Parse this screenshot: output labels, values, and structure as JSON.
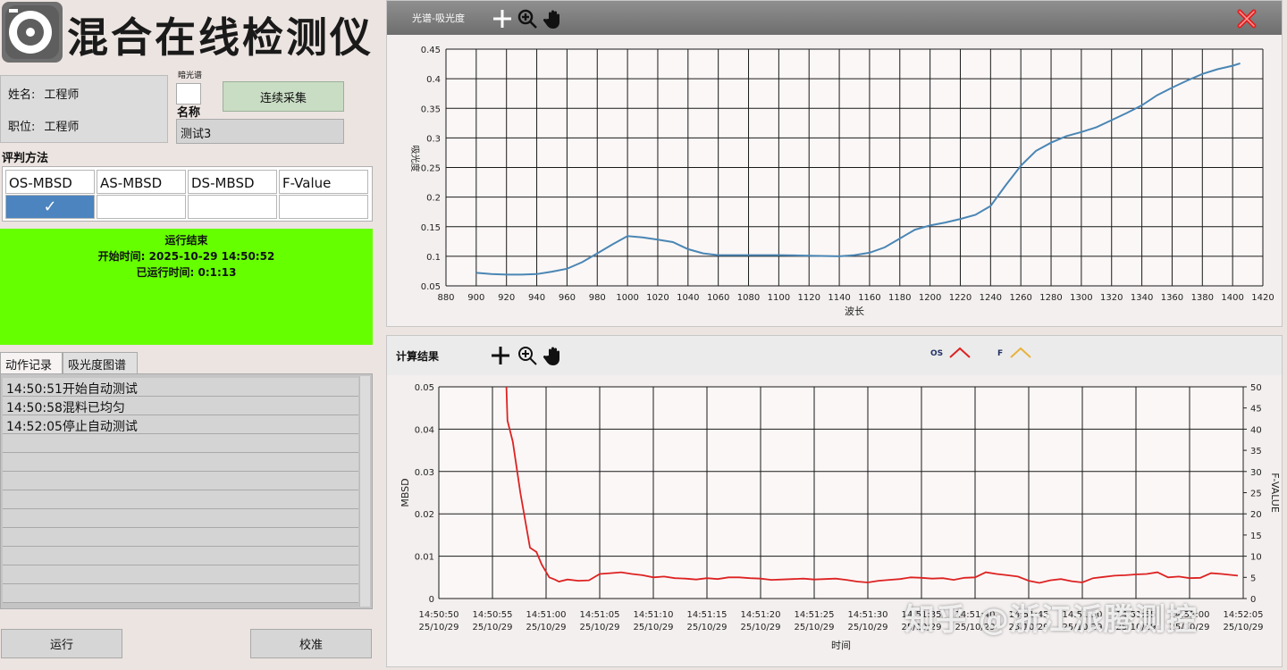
{
  "app": {
    "title": "混合在线检测仪",
    "user": {
      "name_label": "姓名:",
      "name_value": "工程师",
      "role_label": "职位:",
      "role_value": "工程师"
    },
    "dark_spectrum_label": "暗光谱",
    "collect_button": "连续采集",
    "sample_name_label": "名称",
    "sample_name_value": "测试3"
  },
  "method": {
    "label": "评判方法",
    "options": [
      "OS-MBSD",
      "AS-MBSD",
      "DS-MBSD",
      "F-Value"
    ],
    "selected_mark": "✓"
  },
  "status": {
    "title": "运行结束",
    "start_label": "开始时间:",
    "start_value": "2025-10-29 14:50:52",
    "elapsed_label": "已运行时间:",
    "elapsed_value": "0:1:13",
    "color": "#66ff00"
  },
  "tabs": [
    "动作记录",
    "吸光度图谱"
  ],
  "log": [
    "14:50:51开始自动测试",
    "14:50:58混料已均匀",
    "14:52:05停止自动测试"
  ],
  "buttons": {
    "run": "运行",
    "calibrate": "校准"
  },
  "spectrum": {
    "title": "光谱-吸光度",
    "xlabel": "波长",
    "ylabel": "吸光度",
    "icons": [
      "crosshair-icon",
      "zoom-icon",
      "pan-hand-icon",
      "close-icon"
    ]
  },
  "calc": {
    "title": "计算结果",
    "xlabel": "时间",
    "ylabel_left": "MBSD",
    "ylabel_right": "F-VALUE",
    "legend": [
      {
        "name": "OS",
        "color": "#dd2222"
      },
      {
        "name": "F",
        "color": "#e8b23a"
      }
    ]
  },
  "watermark": "知乎 @浙江派腾测控",
  "chart_data": [
    {
      "type": "line",
      "title": "光谱-吸光度",
      "xlabel": "波长",
      "ylabel": "吸光度",
      "xlim": [
        880,
        1420
      ],
      "ylim": [
        0.05,
        0.45
      ],
      "xticks": [
        "880",
        "900",
        "920",
        "940",
        "960",
        "980",
        "1000",
        "1020",
        "1040",
        "1060",
        "1080",
        "1100",
        "1120",
        "1140",
        "1160",
        "1180",
        "1200",
        "1220",
        "1240",
        "1260",
        "1280",
        "1300",
        "1320",
        "1340",
        "1360",
        "1380",
        "1400",
        "1420"
      ],
      "yticks": [
        "0.05",
        "0.1",
        "0.15",
        "0.2",
        "0.25",
        "0.3",
        "0.35",
        "0.4",
        "0.45"
      ],
      "grid": true,
      "series": [
        {
          "color": "#4a86b4",
          "x": [
            900,
            910,
            920,
            930,
            940,
            950,
            960,
            970,
            980,
            990,
            1000,
            1010,
            1020,
            1030,
            1040,
            1050,
            1060,
            1080,
            1100,
            1120,
            1140,
            1150,
            1160,
            1170,
            1180,
            1190,
            1200,
            1210,
            1220,
            1230,
            1240,
            1250,
            1260,
            1270,
            1280,
            1290,
            1300,
            1310,
            1320,
            1330,
            1340,
            1350,
            1360,
            1370,
            1380,
            1390,
            1400,
            1405
          ],
          "y": [
            0.072,
            0.07,
            0.069,
            0.069,
            0.07,
            0.074,
            0.079,
            0.09,
            0.105,
            0.12,
            0.134,
            0.132,
            0.128,
            0.124,
            0.112,
            0.105,
            0.102,
            0.102,
            0.102,
            0.101,
            0.1,
            0.102,
            0.106,
            0.115,
            0.13,
            0.145,
            0.152,
            0.157,
            0.163,
            0.17,
            0.185,
            0.22,
            0.253,
            0.278,
            0.292,
            0.303,
            0.31,
            0.318,
            0.33,
            0.342,
            0.355,
            0.372,
            0.385,
            0.397,
            0.408,
            0.416,
            0.422,
            0.426
          ]
        }
      ]
    },
    {
      "type": "line",
      "title": "计算结果",
      "xlabel": "时间",
      "ylabel": "MBSD",
      "y2label": "F-VALUE",
      "ylim": [
        0,
        0.05
      ],
      "y2lim": [
        0,
        50
      ],
      "yticks": [
        "0",
        "0.01",
        "0.02",
        "0.03",
        "0.04",
        "0.05"
      ],
      "y2ticks": [
        "0",
        "5",
        "10",
        "15",
        "20",
        "25",
        "30",
        "35",
        "40",
        "45",
        "50"
      ],
      "xticks": [
        [
          "14:50:50",
          "25/10/29"
        ],
        [
          "14:50:55",
          "25/10/29"
        ],
        [
          "14:51:00",
          "25/10/29"
        ],
        [
          "14:51:05",
          "25/10/29"
        ],
        [
          "14:51:10",
          "25/10/29"
        ],
        [
          "14:51:15",
          "25/10/29"
        ],
        [
          "14:51:20",
          "25/10/29"
        ],
        [
          "14:51:25",
          "25/10/29"
        ],
        [
          "14:51:30",
          "25/10/29"
        ],
        [
          "14:51:35",
          "25/10/29"
        ],
        [
          "14:51:40",
          "25/10/29"
        ],
        [
          "14:51:45",
          "25/10/29"
        ],
        [
          "14:51:50",
          "25/10/29"
        ],
        [
          "14:51:55",
          "25/10/29"
        ],
        [
          "14:52:00",
          "25/10/29"
        ],
        [
          "14:52:05",
          "25/10/29"
        ]
      ],
      "xlim_seconds_after_14_50_50": [
        0,
        75
      ],
      "grid": true,
      "legend_placement": "top",
      "series": [
        {
          "name": "OS",
          "color": "#dd2222",
          "t_seconds_after_14_50_50": [
            6.3,
            6.4,
            6.9,
            7.6,
            8.5,
            9.1,
            9.6,
            10.3,
            10.8,
            11.2,
            12,
            13,
            14,
            15,
            16,
            17,
            18,
            19,
            20,
            21,
            22,
            23,
            24,
            25,
            26,
            27,
            28,
            29,
            30,
            31,
            32,
            33,
            34,
            35,
            36,
            37,
            38,
            39,
            40,
            41,
            42,
            43,
            44,
            45,
            46,
            47,
            48,
            49,
            50,
            51,
            52,
            53,
            54,
            55,
            56,
            57,
            58,
            59,
            60,
            61,
            62,
            63,
            64,
            65,
            66,
            67,
            68,
            69,
            70,
            71,
            72,
            73,
            74.5
          ],
          "values": [
            0.05,
            0.042,
            0.037,
            0.025,
            0.012,
            0.011,
            0.008,
            0.005,
            0.0045,
            0.004,
            0.0045,
            0.0042,
            0.0043,
            0.0058,
            0.006,
            0.0062,
            0.0058,
            0.0055,
            0.005,
            0.0052,
            0.0048,
            0.0047,
            0.0045,
            0.0048,
            0.0046,
            0.005,
            0.005,
            0.0048,
            0.0047,
            0.0044,
            0.0045,
            0.0046,
            0.0047,
            0.0045,
            0.0046,
            0.0047,
            0.0044,
            0.004,
            0.0038,
            0.0042,
            0.0044,
            0.0046,
            0.005,
            0.0049,
            0.0047,
            0.0048,
            0.0044,
            0.0049,
            0.005,
            0.0062,
            0.0058,
            0.0055,
            0.0052,
            0.0042,
            0.0037,
            0.0043,
            0.0046,
            0.0041,
            0.0038,
            0.0048,
            0.0051,
            0.0054,
            0.0055,
            0.0057,
            0.0058,
            0.0062,
            0.005,
            0.0052,
            0.0048,
            0.0049,
            0.006,
            0.0058,
            0.0054,
            0.0055,
            0.0048
          ]
        }
      ]
    }
  ]
}
